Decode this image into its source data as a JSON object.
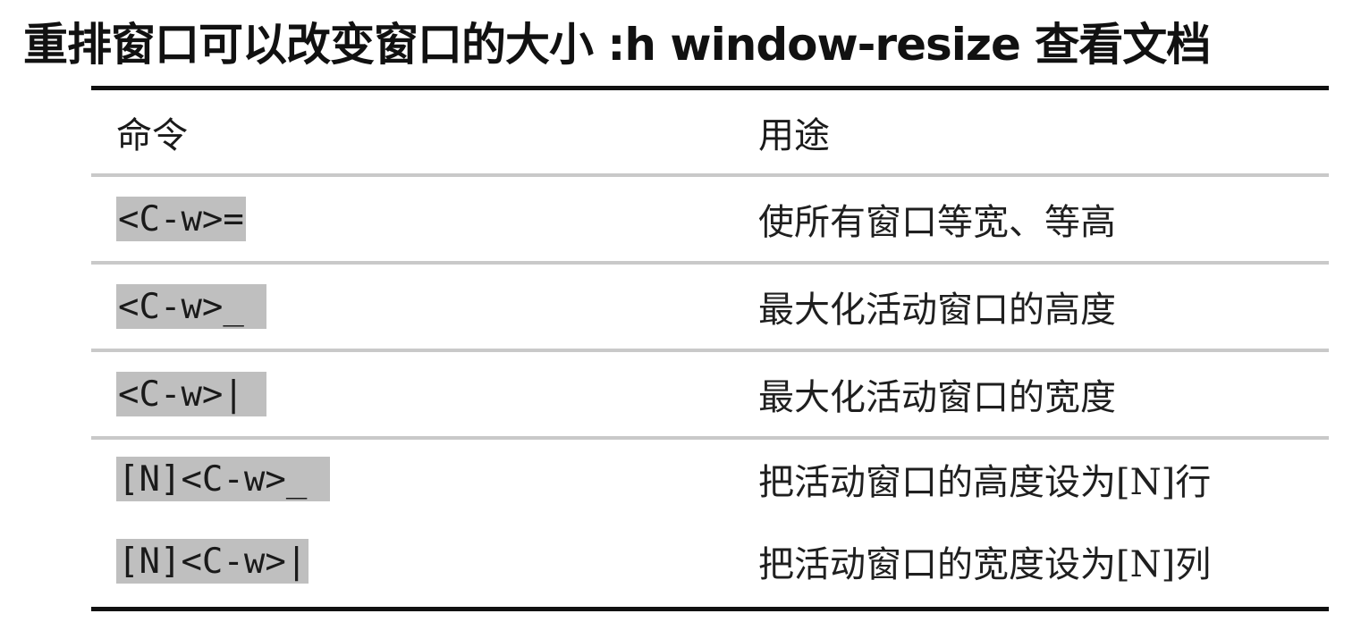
{
  "title": "重排窗口可以改变窗口的大小 :h window-resize 查看文档",
  "table": {
    "headers": {
      "command": "命令",
      "purpose": "用途"
    },
    "rows": [
      {
        "command": "<C-w>=",
        "purpose": "使所有窗口等宽、等高"
      },
      {
        "command": "<C-w>_ ",
        "purpose": "最大化活动窗口的高度"
      },
      {
        "command": "<C-w>| ",
        "purpose": "最大化活动窗口的宽度"
      },
      {
        "command": "[N]<C-w>_ ",
        "purpose": "把活动窗口的高度设为[N]行"
      },
      {
        "command": "[N]<C-w>|",
        "purpose": "把活动窗口的宽度设为[N]列"
      }
    ]
  },
  "colors": {
    "command_highlight": "#bfbfbf",
    "rule": "#111111",
    "row_separator": "#c9c9c9"
  }
}
